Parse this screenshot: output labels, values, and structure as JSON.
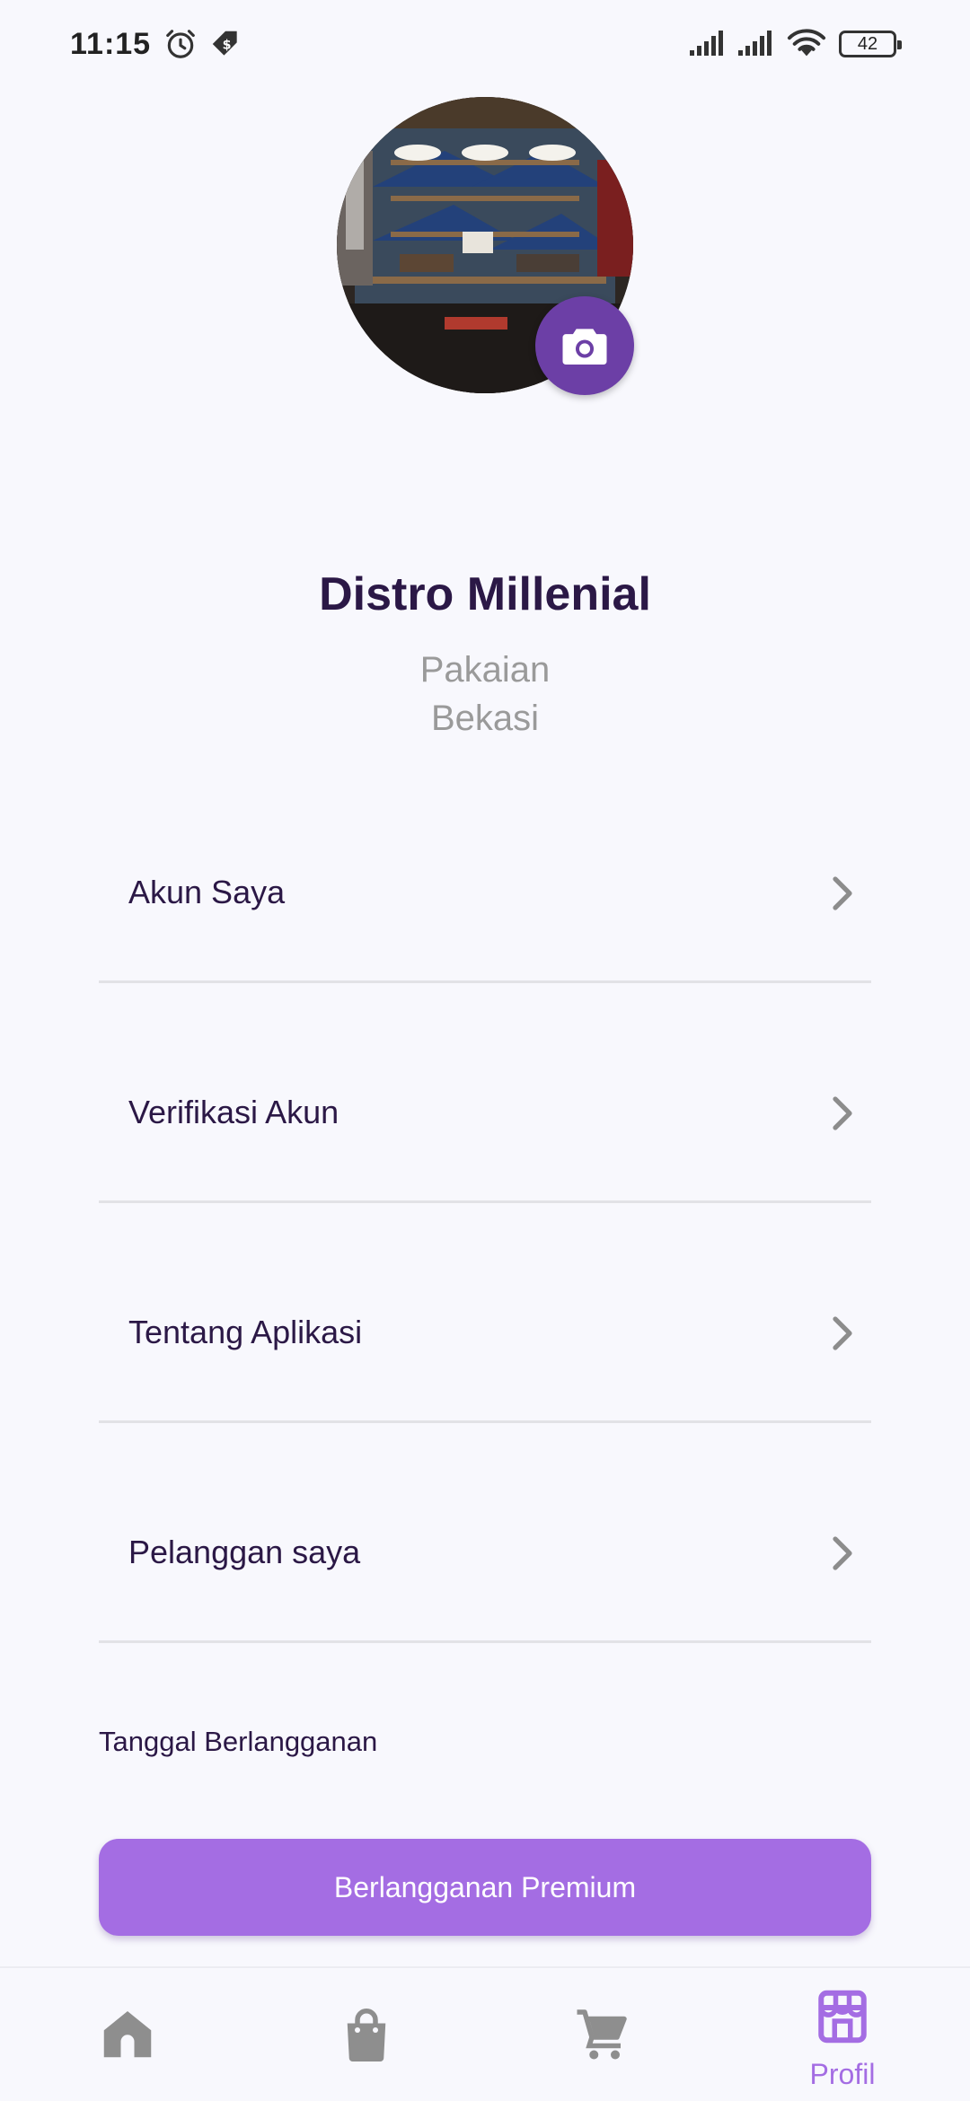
{
  "status_bar": {
    "time": "11:15",
    "battery": "42",
    "icons": [
      "alarm-icon",
      "tag-icon",
      "signal-icon",
      "signal-icon",
      "wifi-icon",
      "battery-icon"
    ]
  },
  "profile": {
    "avatar_icon": "store-photo",
    "camera_icon": "camera-icon",
    "name": "Distro Millenial",
    "category": "Pakaian",
    "city": "Bekasi"
  },
  "menu": {
    "items": [
      {
        "label": "Akun Saya"
      },
      {
        "label": "Verifikasi Akun"
      },
      {
        "label": "Tentang Aplikasi"
      },
      {
        "label": "Pelanggan saya"
      }
    ]
  },
  "subscription": {
    "date_label": "Tanggal Berlangganan",
    "premium_button": "Berlangganan Premium"
  },
  "bottom_nav": {
    "items": [
      {
        "icon": "home-icon"
      },
      {
        "icon": "shopping-bag-icon"
      },
      {
        "icon": "cart-icon"
      },
      {
        "icon": "store-icon",
        "label": "Profil"
      }
    ]
  },
  "colors": {
    "accent": "#a46de3",
    "accent_dark": "#6c3fa6",
    "text_primary": "#2b1846",
    "text_muted": "#9a9a9a",
    "background": "#f8f8fd"
  }
}
